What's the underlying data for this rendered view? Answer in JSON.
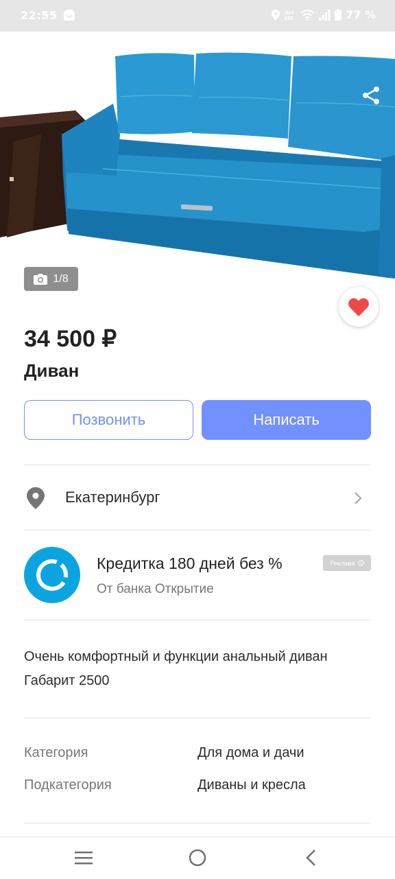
{
  "status_bar": {
    "time": "22:55",
    "battery_percent": "77 %",
    "icons": [
      "message-icon",
      "location-icon",
      "volte-icon",
      "wifi-icon",
      "signal-icon",
      "battery-icon"
    ]
  },
  "gallery": {
    "counter": "1/8",
    "camera_icon": "camera-icon",
    "share_icon": "share-icon",
    "favorite_icon": "heart-icon",
    "favorite_color": "#f04848"
  },
  "listing": {
    "price": "34 500 ₽",
    "title": "Диван"
  },
  "actions": {
    "call_label": "Позвонить",
    "write_label": "Написать",
    "accent_color": "#7390ff"
  },
  "location": {
    "city": "Екатеринбург",
    "icon": "location-pin-icon",
    "chevron": "chevron-right-icon"
  },
  "ad": {
    "title": "Кредитка 180 дней без %",
    "subtitle": "От банка Открытие",
    "badge": "Реклама",
    "logo_color": "#0aa5e1"
  },
  "description": {
    "lines": [
      "Очень комфортный и функции анальный диван",
      "Габарит 2500"
    ]
  },
  "properties": [
    {
      "label": "Категория",
      "value": "Для дома и дачи"
    },
    {
      "label": "Подкатегория",
      "value": "Диваны и кресла"
    }
  ],
  "nav": {
    "icons": [
      "menu-icon",
      "home-icon",
      "back-icon"
    ]
  }
}
